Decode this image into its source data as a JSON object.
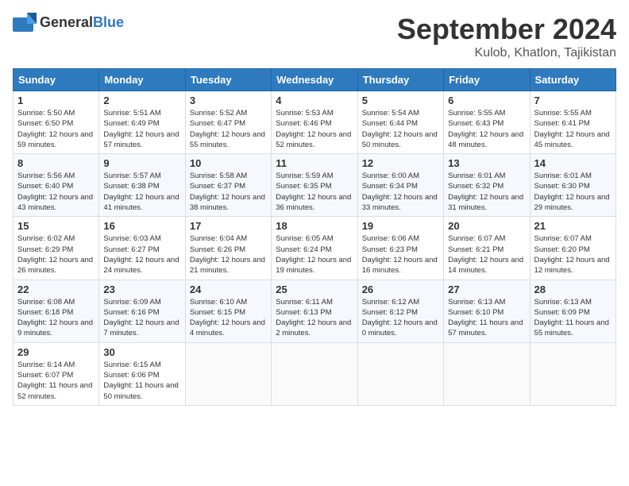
{
  "header": {
    "logo_general": "General",
    "logo_blue": "Blue",
    "month": "September 2024",
    "location": "Kulob, Khatlon, Tajikistan"
  },
  "weekdays": [
    "Sunday",
    "Monday",
    "Tuesday",
    "Wednesday",
    "Thursday",
    "Friday",
    "Saturday"
  ],
  "weeks": [
    [
      {
        "day": "1",
        "sunrise": "5:50 AM",
        "sunset": "6:50 PM",
        "daylight": "12 hours and 59 minutes."
      },
      {
        "day": "2",
        "sunrise": "5:51 AM",
        "sunset": "6:49 PM",
        "daylight": "12 hours and 57 minutes."
      },
      {
        "day": "3",
        "sunrise": "5:52 AM",
        "sunset": "6:47 PM",
        "daylight": "12 hours and 55 minutes."
      },
      {
        "day": "4",
        "sunrise": "5:53 AM",
        "sunset": "6:46 PM",
        "daylight": "12 hours and 52 minutes."
      },
      {
        "day": "5",
        "sunrise": "5:54 AM",
        "sunset": "6:44 PM",
        "daylight": "12 hours and 50 minutes."
      },
      {
        "day": "6",
        "sunrise": "5:55 AM",
        "sunset": "6:43 PM",
        "daylight": "12 hours and 48 minutes."
      },
      {
        "day": "7",
        "sunrise": "5:55 AM",
        "sunset": "6:41 PM",
        "daylight": "12 hours and 45 minutes."
      }
    ],
    [
      {
        "day": "8",
        "sunrise": "5:56 AM",
        "sunset": "6:40 PM",
        "daylight": "12 hours and 43 minutes."
      },
      {
        "day": "9",
        "sunrise": "5:57 AM",
        "sunset": "6:38 PM",
        "daylight": "12 hours and 41 minutes."
      },
      {
        "day": "10",
        "sunrise": "5:58 AM",
        "sunset": "6:37 PM",
        "daylight": "12 hours and 38 minutes."
      },
      {
        "day": "11",
        "sunrise": "5:59 AM",
        "sunset": "6:35 PM",
        "daylight": "12 hours and 36 minutes."
      },
      {
        "day": "12",
        "sunrise": "6:00 AM",
        "sunset": "6:34 PM",
        "daylight": "12 hours and 33 minutes."
      },
      {
        "day": "13",
        "sunrise": "6:01 AM",
        "sunset": "6:32 PM",
        "daylight": "12 hours and 31 minutes."
      },
      {
        "day": "14",
        "sunrise": "6:01 AM",
        "sunset": "6:30 PM",
        "daylight": "12 hours and 29 minutes."
      }
    ],
    [
      {
        "day": "15",
        "sunrise": "6:02 AM",
        "sunset": "6:29 PM",
        "daylight": "12 hours and 26 minutes."
      },
      {
        "day": "16",
        "sunrise": "6:03 AM",
        "sunset": "6:27 PM",
        "daylight": "12 hours and 24 minutes."
      },
      {
        "day": "17",
        "sunrise": "6:04 AM",
        "sunset": "6:26 PM",
        "daylight": "12 hours and 21 minutes."
      },
      {
        "day": "18",
        "sunrise": "6:05 AM",
        "sunset": "6:24 PM",
        "daylight": "12 hours and 19 minutes."
      },
      {
        "day": "19",
        "sunrise": "6:06 AM",
        "sunset": "6:23 PM",
        "daylight": "12 hours and 16 minutes."
      },
      {
        "day": "20",
        "sunrise": "6:07 AM",
        "sunset": "6:21 PM",
        "daylight": "12 hours and 14 minutes."
      },
      {
        "day": "21",
        "sunrise": "6:07 AM",
        "sunset": "6:20 PM",
        "daylight": "12 hours and 12 minutes."
      }
    ],
    [
      {
        "day": "22",
        "sunrise": "6:08 AM",
        "sunset": "6:18 PM",
        "daylight": "12 hours and 9 minutes."
      },
      {
        "day": "23",
        "sunrise": "6:09 AM",
        "sunset": "6:16 PM",
        "daylight": "12 hours and 7 minutes."
      },
      {
        "day": "24",
        "sunrise": "6:10 AM",
        "sunset": "6:15 PM",
        "daylight": "12 hours and 4 minutes."
      },
      {
        "day": "25",
        "sunrise": "6:11 AM",
        "sunset": "6:13 PM",
        "daylight": "12 hours and 2 minutes."
      },
      {
        "day": "26",
        "sunrise": "6:12 AM",
        "sunset": "6:12 PM",
        "daylight": "12 hours and 0 minutes."
      },
      {
        "day": "27",
        "sunrise": "6:13 AM",
        "sunset": "6:10 PM",
        "daylight": "11 hours and 57 minutes."
      },
      {
        "day": "28",
        "sunrise": "6:13 AM",
        "sunset": "6:09 PM",
        "daylight": "11 hours and 55 minutes."
      }
    ],
    [
      {
        "day": "29",
        "sunrise": "6:14 AM",
        "sunset": "6:07 PM",
        "daylight": "11 hours and 52 minutes."
      },
      {
        "day": "30",
        "sunrise": "6:15 AM",
        "sunset": "6:06 PM",
        "daylight": "11 hours and 50 minutes."
      },
      null,
      null,
      null,
      null,
      null
    ]
  ]
}
